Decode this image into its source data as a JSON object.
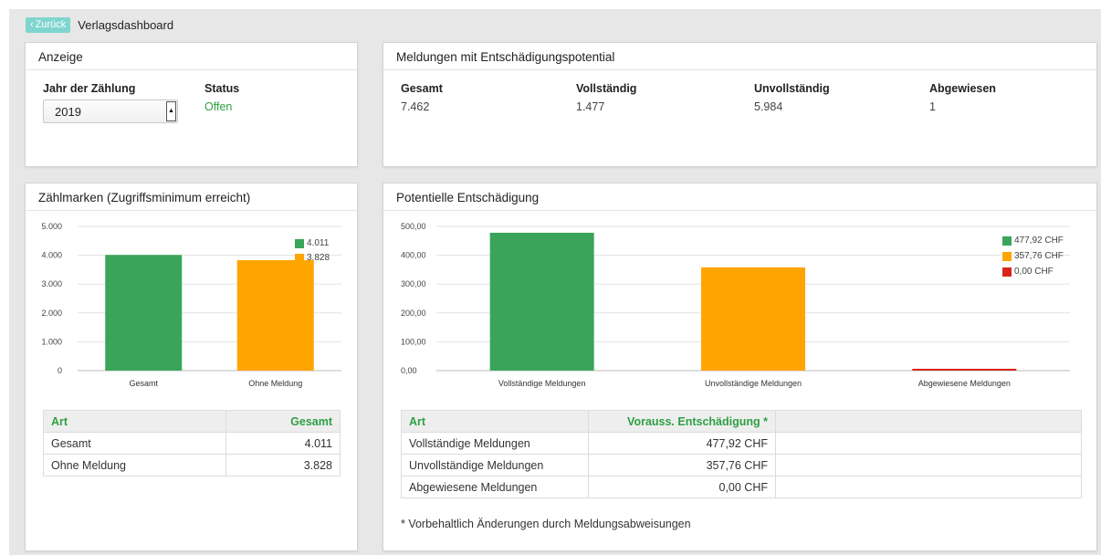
{
  "nav": {
    "back_label": "Zurück",
    "title": "Verlagsdashboard"
  },
  "anzeige": {
    "heading": "Anzeige",
    "year_label": "Jahr der Zählung",
    "year_value": "2019",
    "status_label": "Status",
    "status_value": "Offen"
  },
  "meldungen": {
    "heading": "Meldungen mit Entschädigungspotential",
    "stats": [
      {
        "label": "Gesamt",
        "value": "7.462"
      },
      {
        "label": "Vollständig",
        "value": "1.477"
      },
      {
        "label": "Unvollständig",
        "value": "5.984"
      },
      {
        "label": "Abgewiesen",
        "value": "1"
      }
    ]
  },
  "zaehlmarken": {
    "heading": "Zählmarken (Zugriffsminimum erreicht)",
    "table_headers": [
      "Art",
      "Gesamt"
    ],
    "rows": [
      {
        "art": "Gesamt",
        "gesamt": "4.011"
      },
      {
        "art": "Ohne Meldung",
        "gesamt": "3.828"
      }
    ],
    "legend": [
      "4.011",
      "3.828"
    ]
  },
  "entschaedigung": {
    "heading": "Potentielle Entschädigung",
    "table_headers": [
      "Art",
      "Vorauss. Entschädigung *"
    ],
    "rows": [
      {
        "art": "Vollständige Meldungen",
        "value": "477,92 CHF"
      },
      {
        "art": "Unvollständige Meldungen",
        "value": "357,76 CHF"
      },
      {
        "art": "Abgewiesene Meldungen",
        "value": "0,00 CHF"
      }
    ],
    "legend": [
      "477,92 CHF",
      "357,76 CHF",
      "0,00 CHF"
    ],
    "footnote": "* Vorbehaltlich Änderungen durch Meldungsabweisungen"
  },
  "colors": {
    "green": "#3aa55a",
    "orange": "#ffa500",
    "red": "#d8261b",
    "accent_text": "#2ea043",
    "back_button": "#7fd6cf"
  },
  "chart_data": [
    {
      "type": "bar",
      "categories": [
        "Gesamt",
        "Ohne Meldung"
      ],
      "values": [
        4011,
        3828
      ],
      "colors": [
        "#3aa55a",
        "#ffa500"
      ],
      "yticks": [
        "0",
        "1.000",
        "2.000",
        "3.000",
        "4.000",
        "5.000"
      ],
      "ylim": [
        0,
        5000
      ],
      "legend_position": "top-right"
    },
    {
      "type": "bar",
      "categories": [
        "Vollständige Meldungen",
        "Unvollständige Meldungen",
        "Abgewiesene Meldungen"
      ],
      "values": [
        477.92,
        357.76,
        0
      ],
      "colors": [
        "#3aa55a",
        "#ffa500",
        "#d8261b"
      ],
      "yticks": [
        "0,00",
        "100,00",
        "200,00",
        "300,00",
        "400,00",
        "500,00"
      ],
      "ylim": [
        0,
        500
      ],
      "legend_position": "top-right"
    }
  ]
}
